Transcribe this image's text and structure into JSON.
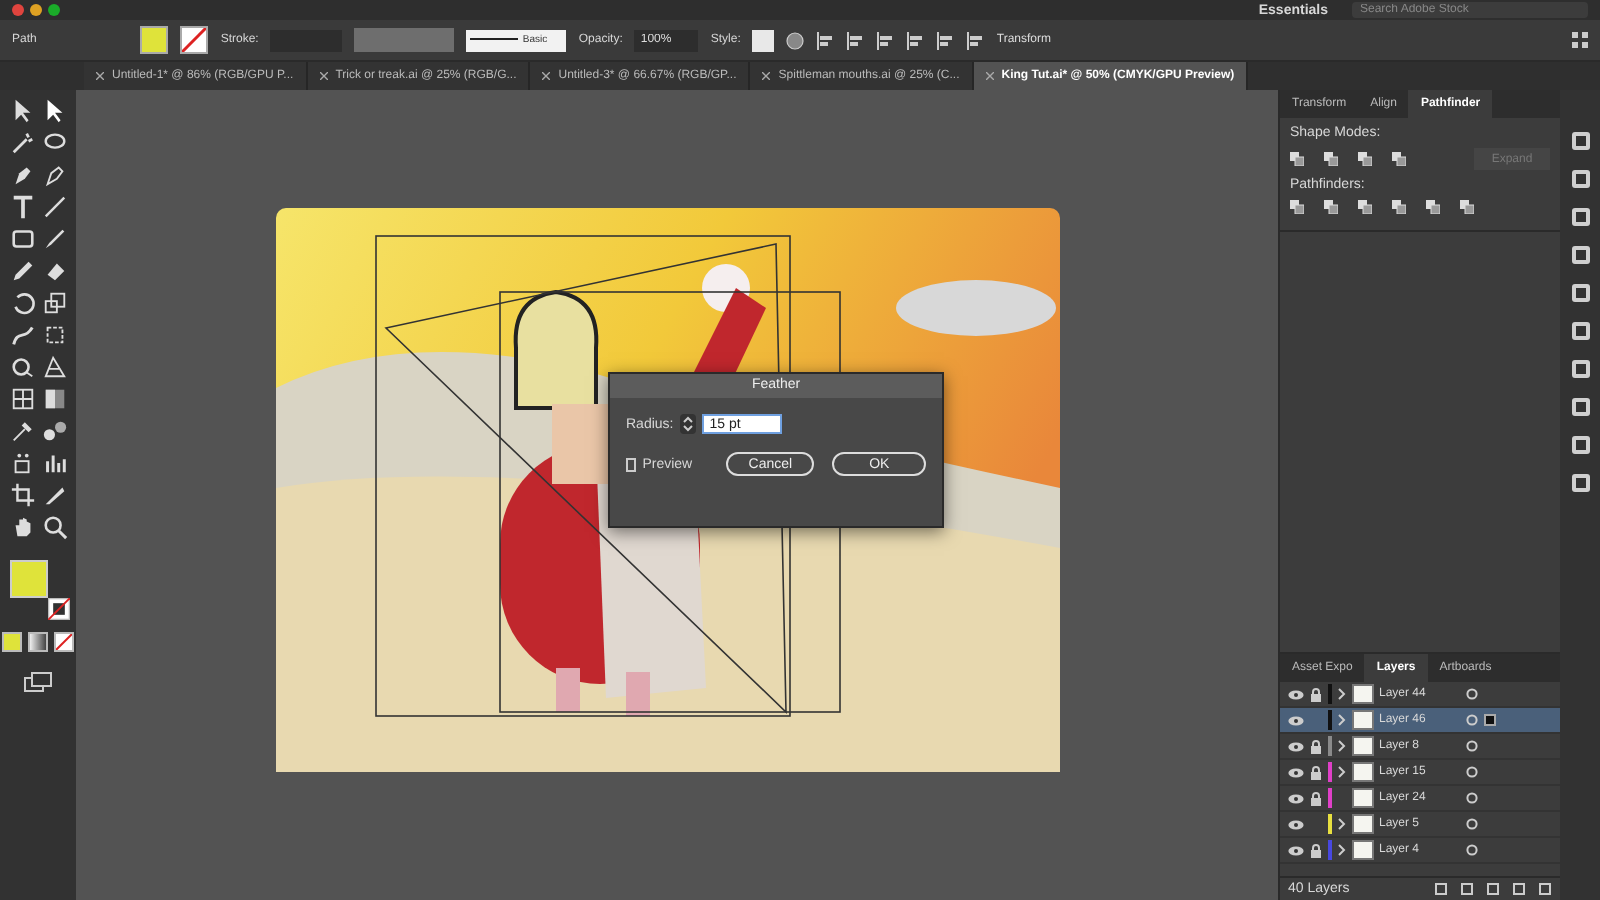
{
  "menubar": {
    "workspace": "Essentials",
    "search": {
      "placeholder": "Search Adobe Stock"
    }
  },
  "control_bar": {
    "object": "Path",
    "stroke_label": "Stroke:",
    "brush": "Basic",
    "opacity_label": "Opacity:",
    "opacity": "100%",
    "style_label": "Style:",
    "transform": "Transform"
  },
  "tabs": [
    {
      "label": "Untitled-1* @ 86% (RGB/GPU P...",
      "selected": false
    },
    {
      "label": "Trick or treak.ai @ 25% (RGB/G...",
      "selected": false
    },
    {
      "label": "Untitled-3* @ 66.67% (RGB/GP...",
      "selected": false
    },
    {
      "label": "Spittleman mouths.ai @ 25% (C...",
      "selected": false
    },
    {
      "label": "King Tut.ai* @ 50% (CMYK/GPU Preview)",
      "selected": true
    }
  ],
  "pathfinder_panel": {
    "tabs": [
      {
        "label": "Transform",
        "selected": false
      },
      {
        "label": "Align",
        "selected": false
      },
      {
        "label": "Pathfinder",
        "selected": true
      }
    ],
    "shape_modes_label": "Shape Modes:",
    "expand_button": {
      "label": "Expand",
      "disabled": true
    },
    "pathfinders_label": "Pathfinders:"
  },
  "layers_panel": {
    "tabs": [
      {
        "label": "Asset Expo",
        "selected": false
      },
      {
        "label": "Layers",
        "selected": true
      },
      {
        "label": "Artboards",
        "selected": false
      }
    ],
    "layers": [
      {
        "name": "Layer 44",
        "color": "#111111",
        "locked": true,
        "expandable": true,
        "selected": false
      },
      {
        "name": "Layer 46",
        "color": "#111111",
        "locked": false,
        "expandable": true,
        "selected": true
      },
      {
        "name": "Layer 8",
        "color": "#8a8a8a",
        "locked": true,
        "expandable": true,
        "selected": false
      },
      {
        "name": "Layer 15",
        "color": "#e040c8",
        "locked": true,
        "expandable": true,
        "selected": false
      },
      {
        "name": "Layer 24",
        "color": "#e040c8",
        "locked": true,
        "expandable": false,
        "selected": false
      },
      {
        "name": "Layer 5",
        "color": "#e8e040",
        "locked": false,
        "expandable": true,
        "selected": false
      },
      {
        "name": "Layer 4",
        "color": "#4848e0",
        "locked": true,
        "expandable": true,
        "selected": false
      }
    ],
    "count": "40 Layers"
  },
  "feather_dialog": {
    "title": "Feather",
    "radius_label": "Radius:",
    "radius": "15 pt",
    "preview": {
      "label": "Preview",
      "checked": false
    },
    "buttons": [
      "Cancel",
      "OK"
    ]
  }
}
